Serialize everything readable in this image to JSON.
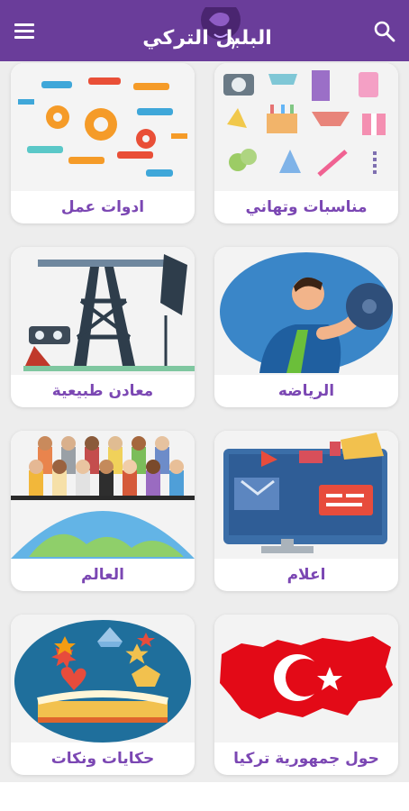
{
  "header": {
    "title": "البلبل التركي",
    "menu_icon": "hamburger-icon",
    "search_icon": "search-icon",
    "bar_color": "#6a3d9a",
    "accent_color": "#7b47b3"
  },
  "categories": [
    {
      "label": "مناسبات وتهاني",
      "icon": "party-celebration-icon"
    },
    {
      "label": "ادوات عمل",
      "icon": "tools-icon"
    },
    {
      "label": "الرياضه",
      "icon": "weightlifter-icon"
    },
    {
      "label": "معادن طبيعية",
      "icon": "oil-pump-icon"
    },
    {
      "label": "اعلام",
      "icon": "media-monitor-icon"
    },
    {
      "label": "العالم",
      "icon": "world-people-icon"
    },
    {
      "label": "حول جمهورية تركيا",
      "icon": "turkey-map-flag-icon"
    },
    {
      "label": "حكايات ونكات",
      "icon": "storybook-icon"
    }
  ]
}
